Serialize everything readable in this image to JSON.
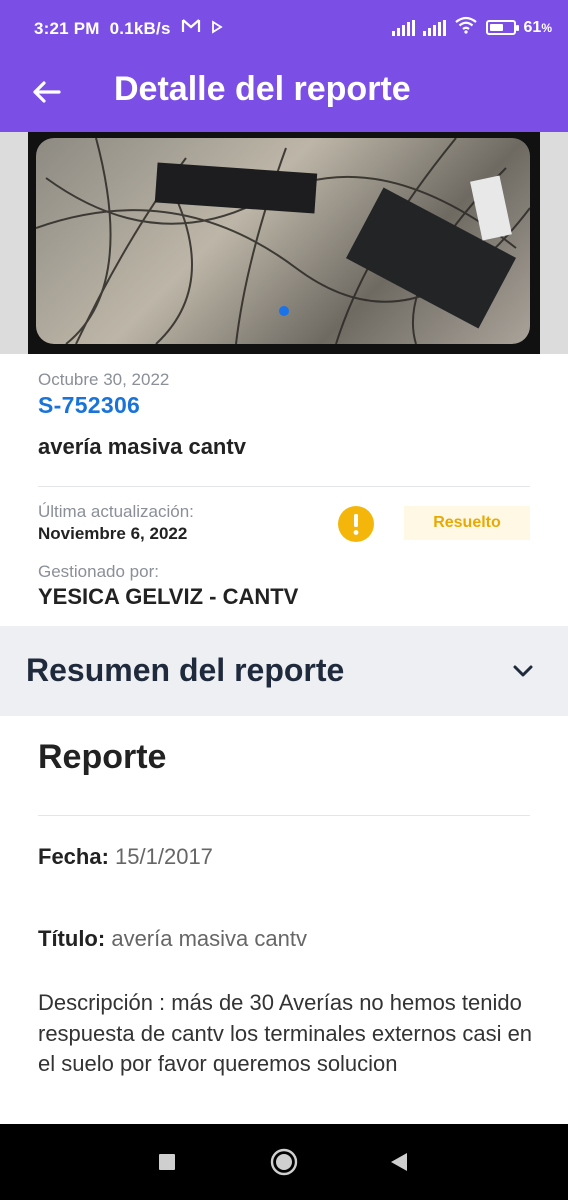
{
  "status_bar": {
    "time": "3:21 PM",
    "speed": "0.1kB/s",
    "battery": "61",
    "battery_unit": "%",
    "battery_level": 0.61,
    "icons": [
      "gmail-icon",
      "play-icon",
      "signal-icon",
      "signal-icon",
      "wifi-icon",
      "battery-icon"
    ]
  },
  "app_bar": {
    "title": "Detalle del reporte",
    "back_icon": "arrow-left-icon"
  },
  "report": {
    "date": "Octubre 30, 2022",
    "code": "S-752306",
    "title": "avería masiva cantv",
    "last_update_label": "Última actualización:",
    "last_update_value": "Noviembre 6, 2022",
    "status_icon": "alert-icon",
    "status": "Resuelto",
    "managed_by_label": "Gestionado por:",
    "managed_by_value": "YESICA GELVIZ - CANTV"
  },
  "summary": {
    "title": "Resumen del reporte",
    "toggle_icon": "chevron-down-icon"
  },
  "details": {
    "section_title": "Reporte",
    "fecha_label": "Fecha:",
    "fecha_value": "15/1/2017",
    "titulo_label": "Título:",
    "titulo_value": "avería masiva cantv",
    "description": "Descripción : más de 30 Averías no hemos tenido respuesta de cantv los terminales externos casi en el suelo por favor queremos solucion"
  },
  "nav_bar": {
    "buttons": [
      "recents-icon",
      "home-icon",
      "back-icon"
    ]
  },
  "colors": {
    "accent": "#7b4fe6",
    "link": "#1a73d8",
    "warning": "#f5b60b",
    "badge_bg": "#fff8e4",
    "summary_bg": "#eeeff2"
  }
}
